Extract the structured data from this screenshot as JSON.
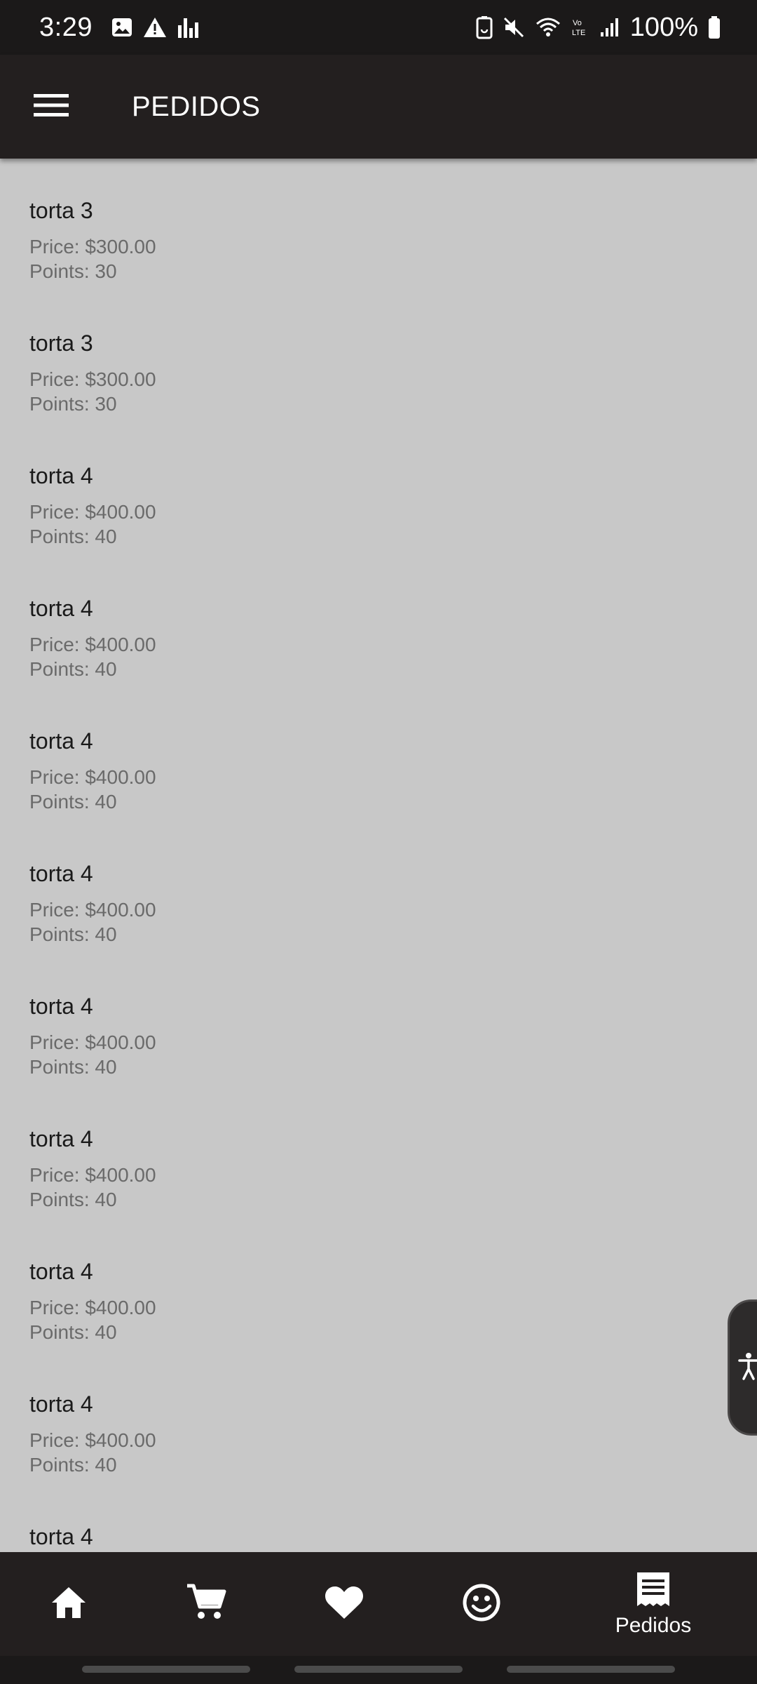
{
  "status_bar": {
    "time": "3:29",
    "battery": "100%",
    "icons_left": [
      "image-icon",
      "warning-icon",
      "signal-bars-icon"
    ],
    "icons_right": [
      "battery-saver-icon",
      "mute-icon",
      "wifi-icon",
      "volte-icon",
      "cell-signal-icon",
      "battery-icon"
    ]
  },
  "app_bar": {
    "title": "PEDIDOS",
    "menu_icon": "hamburger-menu-icon"
  },
  "orders": [
    {
      "name": "torta 3",
      "price": "Price: $300.00",
      "points": "Points: 30"
    },
    {
      "name": "torta 3",
      "price": "Price: $300.00",
      "points": "Points: 30"
    },
    {
      "name": "torta 4",
      "price": "Price: $400.00",
      "points": "Points: 40"
    },
    {
      "name": "torta 4",
      "price": "Price: $400.00",
      "points": "Points: 40"
    },
    {
      "name": "torta 4",
      "price": "Price: $400.00",
      "points": "Points: 40"
    },
    {
      "name": "torta 4",
      "price": "Price: $400.00",
      "points": "Points: 40"
    },
    {
      "name": "torta 4",
      "price": "Price: $400.00",
      "points": "Points: 40"
    },
    {
      "name": "torta 4",
      "price": "Price: $400.00",
      "points": "Points: 40"
    },
    {
      "name": "torta 4",
      "price": "Price: $400.00",
      "points": "Points: 40"
    },
    {
      "name": "torta 4",
      "price": "Price: $400.00",
      "points": "Points: 40"
    },
    {
      "name": "torta 4"
    }
  ],
  "bottom_nav": {
    "items": [
      {
        "icon": "home-icon"
      },
      {
        "icon": "cart-icon"
      },
      {
        "icon": "heart-icon"
      },
      {
        "icon": "smiley-icon"
      },
      {
        "icon": "receipt-icon",
        "label": "Pedidos",
        "active": true
      }
    ]
  },
  "accessibility_button": {
    "icon": "accessibility-icon"
  },
  "colors": {
    "background": "#c8c8c8",
    "app_bar": "#231f1f",
    "status_bar": "#1b1919",
    "primary_text": "#1a1a1a",
    "secondary_text": "#6a6a6a"
  }
}
